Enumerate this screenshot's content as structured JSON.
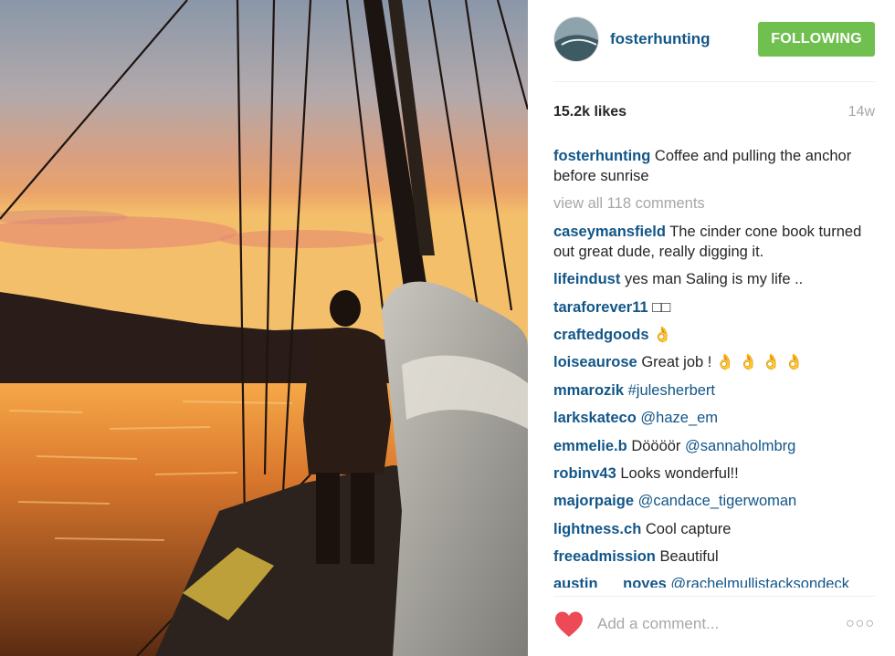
{
  "post": {
    "username": "fosterhunting",
    "follow_label": "FOLLOWING",
    "likes": "15.2k likes",
    "age": "14w",
    "caption": "Coffee and pulling the anchor before sunrise",
    "view_all": "view all 118 comments"
  },
  "comments": [
    {
      "user": "caseymansfield",
      "text": "The cinder cone book turned out great dude, really digging it."
    },
    {
      "user": "lifeindust",
      "text": "yes man Saling is my life .."
    },
    {
      "user": "taraforever11",
      "text": "□□"
    },
    {
      "user": "craftedgoods",
      "text": "👌"
    },
    {
      "user": "loiseaurose",
      "text": "Great job ! 👌 👌 👌 👌"
    },
    {
      "user": "mmarozik",
      "text": "#julesherbert"
    },
    {
      "user": "larkskateco",
      "text": "@haze_em"
    },
    {
      "user": "emmelie.b",
      "text": "Döööör",
      "mention": "@sannaholmbrg"
    },
    {
      "user": "robinv43",
      "text": "Looks wonderful!!"
    },
    {
      "user": "majorpaige",
      "text": "@candace_tigerwoman"
    },
    {
      "user": "lightness.ch",
      "text": "Cool capture"
    },
    {
      "user": "freeadmission",
      "text": "Beautiful"
    },
    {
      "user": "austin___noyes",
      "text": "@rachelmullistacksondeck"
    }
  ],
  "footer": {
    "placeholder": "Add a comment...",
    "more": "○○○"
  },
  "icons": {
    "like": "heart-icon",
    "options": "more-options-icon"
  },
  "colors": {
    "link": "#125688",
    "follow_button": "#70c050",
    "heart": "#ed4956",
    "muted": "#a5a7aa"
  }
}
